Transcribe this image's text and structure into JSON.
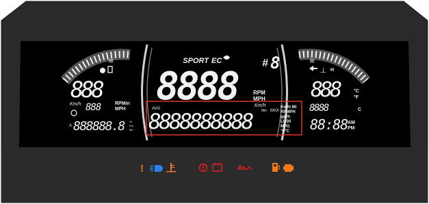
{
  "top": {
    "mode_label": "SPORT",
    "eco_label": "EC",
    "gear_prefix": "#",
    "gear_digit": "8"
  },
  "main": {
    "speed_digits": "8888",
    "speed_unit_rpm": "RPM",
    "speed_unit_mph": "MPH"
  },
  "info": {
    "avg_label": "AVG",
    "message_digits": "8888888888",
    "kmh_label": "Km/h",
    "min_label": "Min",
    "max_label": "MAX",
    "units": [
      "Km/h Mi",
      "RPMPH",
      "gal/h",
      "L/100",
      "MPG",
      "°F°C"
    ]
  },
  "left": {
    "digits_top": "888",
    "kmh_label": "Km/h",
    "small_digits": "888",
    "rpm_min_label": "RPMin",
    "mph_label": "MPH",
    "odometer_prefix": "A",
    "odometer_digits": "888888.8",
    "odo_units": [
      "Hr",
      "Km",
      "Mn"
    ]
  },
  "right": {
    "temp_digits": "888",
    "temp_unit_c": "°C",
    "temp_unit_f": "°F",
    "h_label": "H",
    "c_label": "C",
    "small_digits": "8888",
    "clock_digits": "88:88",
    "am_label": "AM",
    "pm_label": "PM"
  },
  "colors": {
    "bezel": "#2a2a2a",
    "lcd_bg": "#000000",
    "segment": "#f2f2f2",
    "warning_orange": "#f07a1a",
    "warning_red": "#e02020",
    "highbeam_blue": "#2f7fe8",
    "highlight_box": "#e33232"
  },
  "indicators": [
    {
      "icon": "warning-exclamation-icon",
      "glyph": "!",
      "color": "#f07a1a"
    },
    {
      "icon": "high-beam-icon",
      "glyph": "≡D",
      "color": "#2f7fe8"
    },
    {
      "icon": "coolant-temp-icon",
      "glyph": "⊥",
      "color": "#f07a1a"
    },
    {
      "icon": "brake-warning-icon",
      "glyph": "(!)",
      "color": "#e02020"
    },
    {
      "icon": "battery-icon",
      "glyph": "▭",
      "color": "#e02020"
    },
    {
      "icon": "oil-pressure-icon",
      "glyph": "⌐",
      "color": "#e02020"
    },
    {
      "icon": "fuel-pump-icon",
      "glyph": "▯",
      "color": "#f07a1a"
    },
    {
      "icon": "engine-check-icon",
      "glyph": "◼",
      "color": "#f07a1a"
    }
  ]
}
